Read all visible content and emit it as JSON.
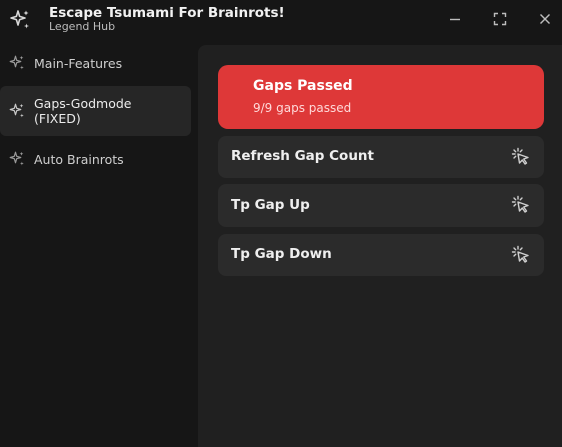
{
  "window": {
    "title": "Escape Tsumami For Brainrots!",
    "subtitle": "Legend Hub",
    "icon": "sparkles-icon",
    "controls": [
      "minimize-icon",
      "maximize-icon",
      "close-icon"
    ]
  },
  "sidebar": {
    "items": [
      {
        "label": "Main-Features",
        "icon": "sparkles-icon",
        "active": false
      },
      {
        "label": "Gaps-Godmode\n(FIXED)",
        "icon": "sparkles-icon",
        "active": true
      },
      {
        "label": "Auto Brainrots",
        "icon": "sparkles-icon",
        "active": false
      }
    ]
  },
  "content": {
    "status": {
      "title": "Gaps Passed",
      "text": "9/9 gaps passed",
      "color": "#de3838"
    },
    "buttons": [
      {
        "label": "Refresh Gap Count",
        "icon": "pointer-click-icon"
      },
      {
        "label": "Tp Gap Up",
        "icon": "pointer-click-icon"
      },
      {
        "label": "Tp Gap Down",
        "icon": "pointer-click-icon"
      }
    ]
  },
  "colors": {
    "background": "#161616",
    "panel": "#202020",
    "card": "#2b2b2b",
    "accent": "#de3838"
  }
}
